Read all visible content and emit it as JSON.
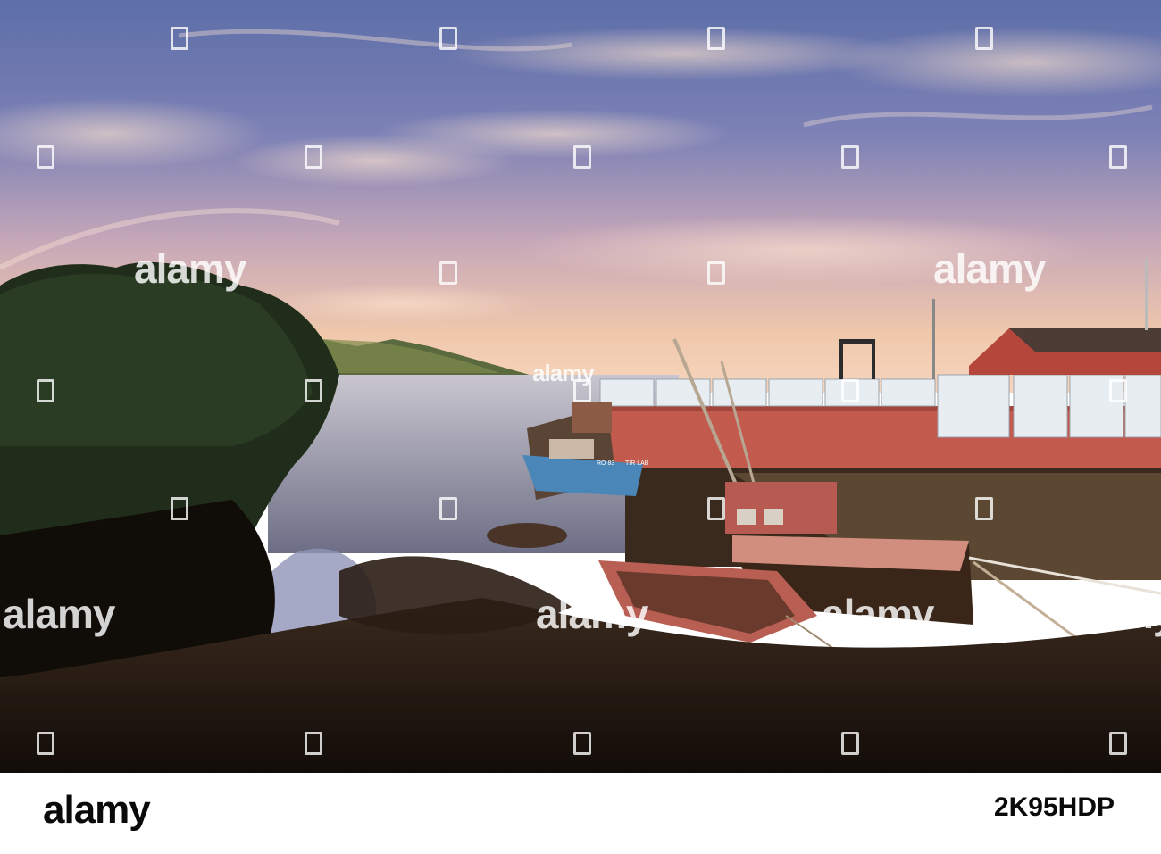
{
  "watermark": {
    "brand": "alamy",
    "image_id": "2K95HDP",
    "color": "#ffffff"
  },
  "scene": {
    "sky_top": "#6f7fb4",
    "sky_horizon": "#f2c8a8",
    "water": "#b8b7c3",
    "quay_wall": "#c85a4c",
    "shed": "#b5463c",
    "boat_blue": "#4a86b8",
    "foreground": "#1d140e"
  },
  "boats": [
    {
      "registration": "RO 83",
      "name": "TIR LAB"
    }
  ]
}
